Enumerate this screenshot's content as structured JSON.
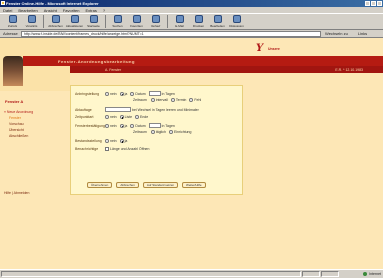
{
  "window": {
    "title": "Fenster Online-Hilfe - Microsoft Internet Explorer"
  },
  "menu": [
    "Datei",
    "Bearbeiten",
    "Ansicht",
    "Favoriten",
    "Extras",
    "?"
  ],
  "toolbar": [
    {
      "label": "Zurück",
      "icon": "back-icon"
    },
    {
      "label": "Vorwärts",
      "icon": "forward-icon"
    },
    {
      "label": "Abbrechen",
      "icon": "stop-icon"
    },
    {
      "label": "Aktualisieren",
      "icon": "refresh-icon"
    },
    {
      "label": "Startseite",
      "icon": "home-icon"
    },
    {
      "label": "Suchen",
      "icon": "search-icon"
    },
    {
      "label": "Favoriten",
      "icon": "favorites-icon"
    },
    {
      "label": "Verlauf",
      "icon": "history-icon"
    },
    {
      "label": "E-Mail",
      "icon": "mail-icon"
    },
    {
      "label": "Drucken",
      "icon": "print-icon"
    },
    {
      "label": "Bearbeiten",
      "icon": "edit-icon"
    },
    {
      "label": "Diskussion",
      "icon": "discuss-icon"
    }
  ],
  "address": {
    "label": "Adresse",
    "url": "http://www.f-inside.de/BIW/content/frames_druck/hilfe/anzeige.html?NUMT=1",
    "go": "Wechseln zu",
    "links": "Links"
  },
  "header": {
    "logo_mark": "Y",
    "logo_text": "Unsere",
    "title": "Fenster-Anordnungsbearbeitung",
    "sub_left": "A. Fenster",
    "sub_right": "E.R. * 12.10.1983"
  },
  "sidebar": {
    "heading": "Fenster A",
    "items": [
      {
        "label": "» Neue Anordnung",
        "state": "active-parent"
      },
      {
        "label": "Fenster",
        "state": "selected"
      },
      {
        "label": "Vorschau",
        "state": ""
      },
      {
        "label": "Übersicht",
        "state": ""
      },
      {
        "label": "Abschließen",
        "state": ""
      }
    ],
    "footer": "Hilfe | Abmelden"
  },
  "form": {
    "rows": [
      {
        "label": "Anbringstellung",
        "opts": [
          "nein",
          "ja",
          "Datum"
        ],
        "checked": 1,
        "box": "in Tagen"
      },
      {
        "label": "",
        "opts": [
          "intervall",
          "Termin",
          "Fehl"
        ],
        "checked": -1,
        "prefix": "Zeitraum"
      },
      {
        "label": "Ablauftage",
        "opts": [],
        "checked": -1,
        "box": "bei Wechsel in Tagen leeren und Minimaler"
      },
      {
        "label": "Zeitpunktart",
        "opts": [
          "nein",
          "Liste",
          "Ende"
        ],
        "checked": 1
      },
      {
        "label": "Fensterbestätigung",
        "opts": [
          "nein",
          "ja",
          "Datum"
        ],
        "checked": 1,
        "box": "in Tagen"
      },
      {
        "label": "",
        "opts": [
          "täglich",
          "Einrichtung"
        ],
        "checked": -1,
        "prefix": "Zeitraum"
      },
      {
        "label": "Bestandsstellung",
        "opts": [
          "nein",
          "ja"
        ],
        "checked": 1
      },
      {
        "label": "Benachrichtige",
        "opts": [],
        "checked": -1,
        "check": "Länge und Anzahl Öffnen"
      }
    ],
    "buttons": [
      "Übernehmen",
      "Abbrechen",
      "Auf Standard setzen",
      "Weiter/Hilfe"
    ]
  },
  "status": {
    "zone": "Internet"
  },
  "colors": {
    "accent_red": "#b51b12",
    "panel": "#fff7cc",
    "background": "#fde7b6",
    "title_blue": "#0a246a"
  }
}
